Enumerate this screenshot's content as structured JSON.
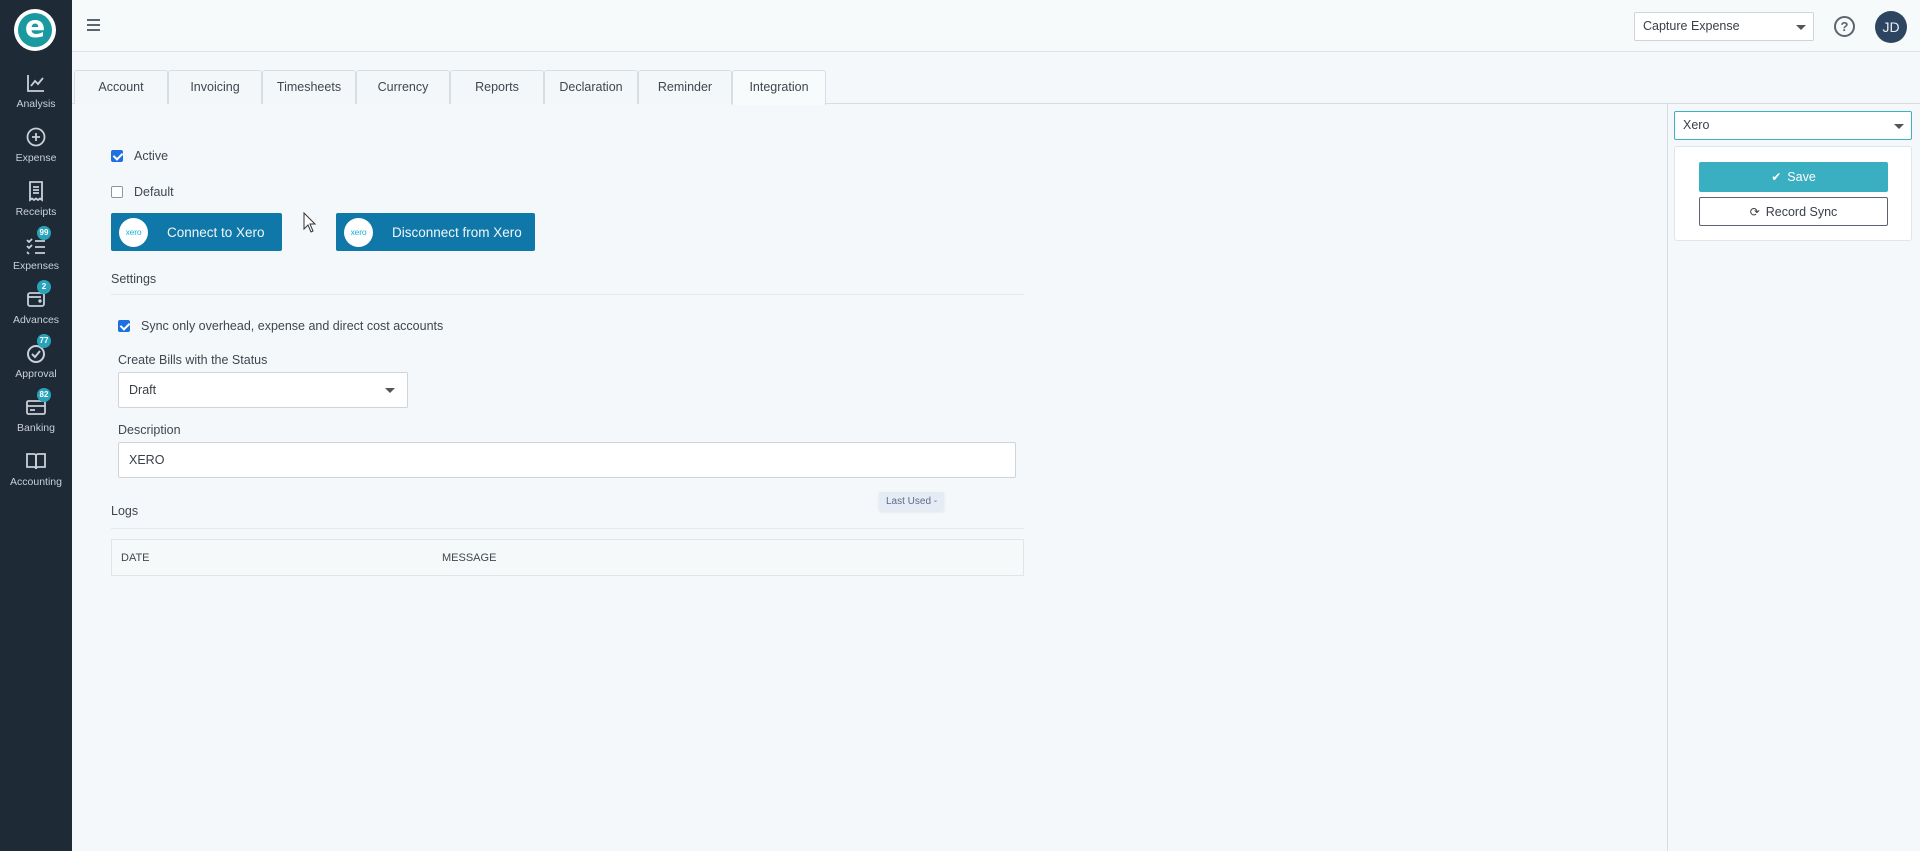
{
  "sidebar": {
    "logo": "e",
    "items": [
      {
        "label": "Analysis",
        "icon": "chart-line-icon",
        "badge": null
      },
      {
        "label": "Expense",
        "icon": "plus-circle-icon",
        "badge": null
      },
      {
        "label": "Receipts",
        "icon": "receipt-icon",
        "badge": null
      },
      {
        "label": "Expenses",
        "icon": "checklist-icon",
        "badge": "99"
      },
      {
        "label": "Advances",
        "icon": "wallet-icon",
        "badge": "2"
      },
      {
        "label": "Approval",
        "icon": "check-circle-icon",
        "badge": "77"
      },
      {
        "label": "Banking",
        "icon": "credit-card-icon",
        "badge": "82"
      },
      {
        "label": "Accounting",
        "icon": "book-icon",
        "badge": null
      }
    ]
  },
  "topbar": {
    "app_select_value": "Capture Expense",
    "help_label": "?",
    "avatar_initials": "JD"
  },
  "tabs": [
    {
      "label": "Account",
      "active": false
    },
    {
      "label": "Invoicing",
      "active": false
    },
    {
      "label": "Timesheets",
      "active": false
    },
    {
      "label": "Currency",
      "active": false
    },
    {
      "label": "Reports",
      "active": false
    },
    {
      "label": "Declaration",
      "active": false
    },
    {
      "label": "Reminder",
      "active": false
    },
    {
      "label": "Integration",
      "active": true
    }
  ],
  "integration": {
    "active_label": "Active",
    "active_checked": true,
    "default_label": "Default",
    "default_checked": false,
    "xero_logo_text": "xero",
    "connect_label": "Connect to Xero",
    "disconnect_label": "Disconnect from Xero",
    "settings_title": "Settings",
    "sync_label": "Sync only overhead, expense and direct cost accounts",
    "sync_checked": true,
    "bill_status_label": "Create Bills with the Status",
    "bill_status_value": "Draft",
    "description_label": "Description",
    "description_value": "XERO",
    "last_used": "Last Used -",
    "logs_title": "Logs",
    "logs_columns": [
      "DATE",
      "MESSAGE"
    ],
    "logs_rows": []
  },
  "right_panel": {
    "provider_value": "Xero",
    "save_label": "Save",
    "record_sync_label": "Record Sync"
  },
  "colors": {
    "sidebar_bg": "#1f2a37",
    "brand_teal": "#1a9aa0",
    "xero_button": "#0f78a8",
    "save_button": "#3aafc2",
    "badge": "#29a3b9",
    "checkbox": "#1e6fe0"
  }
}
